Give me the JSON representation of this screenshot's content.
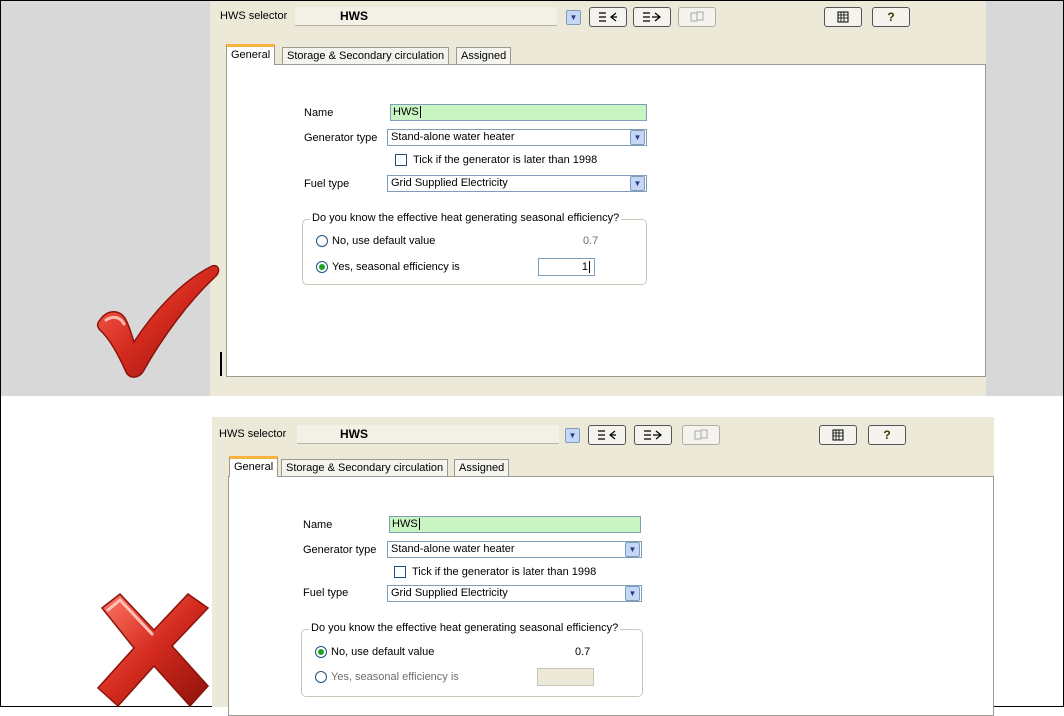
{
  "top_panel": {
    "hws_selector_label": "HWS selector",
    "hws_selector_value": "HWS",
    "tabs": [
      "General",
      "Storage & Secondary circulation",
      "Assigned"
    ],
    "name_label": "Name",
    "name_value": "HWS",
    "generator_type_label": "Generator type",
    "generator_type_value": "Stand-alone water heater",
    "tick_label": "Tick if the generator is later than 1998",
    "fuel_type_label": "Fuel type",
    "fuel_type_value": "Grid Supplied Electricity",
    "efficiency_question": "Do you know the effective heat generating seasonal efficiency?",
    "option_no_label": "No, use default value",
    "default_value": "0.7",
    "option_yes_label": "Yes, seasonal efficiency is",
    "seasonal_efficiency_value": "1",
    "selected_option": "yes"
  },
  "bottom_panel": {
    "hws_selector_label": "HWS selector",
    "hws_selector_value": "HWS",
    "tabs": [
      "General",
      "Storage & Secondary circulation",
      "Assigned"
    ],
    "name_label": "Name",
    "name_value": "HWS",
    "generator_type_label": "Generator type",
    "generator_type_value": "Stand-alone water heater",
    "tick_label": "Tick if the generator is later than 1998",
    "fuel_type_label": "Fuel type",
    "fuel_type_value": "Grid Supplied Electricity",
    "efficiency_question": "Do you know the effective heat generating seasonal efficiency?",
    "option_no_label": "No, use default value",
    "default_value": "0.7",
    "option_yes_label": "Yes, seasonal efficiency is",
    "seasonal_efficiency_value": "",
    "selected_option": "no"
  },
  "annotations": {
    "top_mark": "check-mark-icon",
    "bottom_mark": "cross-mark-icon",
    "colors": {
      "check": "#d42a1e",
      "cross": "#d42a1e",
      "name_field": "#c8f5c1",
      "panel": "#ece9d8",
      "radio_dot": "#21a121"
    }
  }
}
